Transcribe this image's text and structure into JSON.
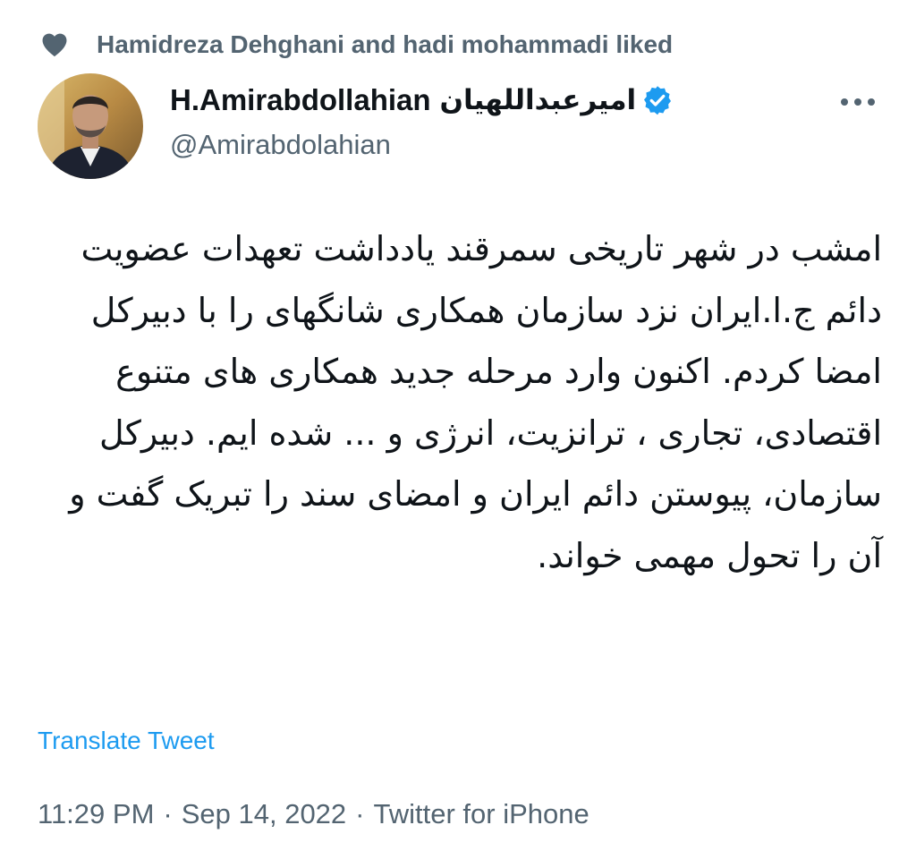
{
  "social_context": {
    "icon": "heart-icon",
    "text": "Hamidreza Dehghani and hadi mohammadi liked"
  },
  "author": {
    "display_name": "H.Amirabdollahian",
    "display_name_fa": "امیرعبداللهیان",
    "handle": "@Amirabdolahian",
    "verified": true,
    "avatar_icon": "avatar"
  },
  "more_icon": "more-icon",
  "tweet": {
    "text": "امشب در شهر تاریخی سمرقند یادداشت تعهدات عضویت دائم ج.ا.ایران نزد سازمان همکاری شانگهای را با دبیرکل امضا کردم. اکنون وارد مرحله جدید همکاری های متنوع اقتصادی، تجاری ، ترانزیت، انرژی و ... شده ایم. دبیرکل سازمان، پیوستن دائم ایران و امضای سند را تبریک گفت و آن را تحول مهمی خواند.",
    "translate_label": "Translate Tweet"
  },
  "meta": {
    "time": "11:29 PM",
    "date": "Sep 14, 2022",
    "source": "Twitter for iPhone",
    "separator": "·"
  },
  "colors": {
    "accent": "#1d9bf0",
    "secondary_text": "#536471",
    "primary_text": "#0f1419"
  }
}
